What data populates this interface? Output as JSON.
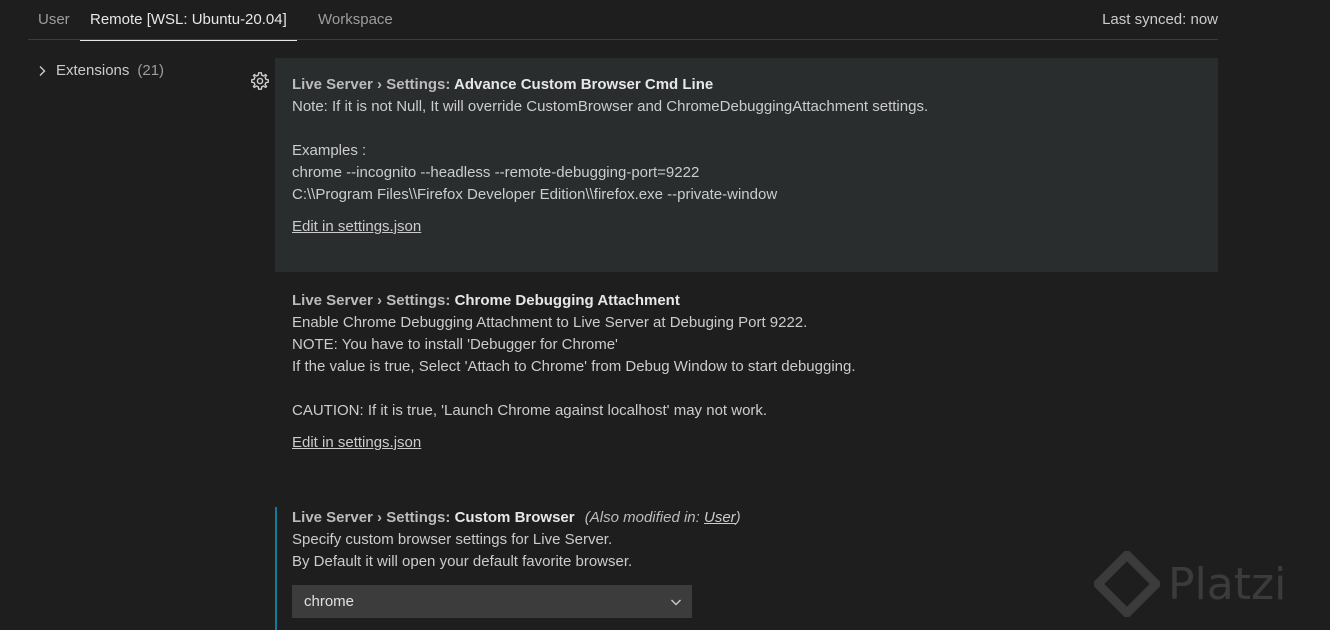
{
  "tabs": [
    {
      "label": "User"
    },
    {
      "label": "Remote [WSL: Ubuntu-20.04]"
    },
    {
      "label": "Workspace"
    }
  ],
  "sync_status": "Last synced: now",
  "toc": {
    "label": "Extensions",
    "count": "(21)"
  },
  "settings": [
    {
      "category": "Live Server › Settings: ",
      "name": "Advance Custom Browser Cmd Line",
      "lines": [
        "Note: If it is not Null, It will override CustomBrowser and ChromeDebuggingAttachment settings.",
        "",
        "Examples :",
        "chrome --incognito --headless --remote-debugging-port=9222",
        "C:\\\\Program Files\\\\Firefox Developer Edition\\\\firefox.exe --private-window"
      ],
      "link": "Edit in settings.json"
    },
    {
      "category": "Live Server › Settings: ",
      "name": "Chrome Debugging Attachment",
      "lines": [
        "Enable Chrome Debugging Attachment to Live Server at Debuging Port 9222.",
        "NOTE: You have to install 'Debugger for Chrome'",
        "If the value is true, Select 'Attach to Chrome' from Debug Window to start debugging.",
        "",
        "CAUTION: If it is true, 'Launch Chrome against localhost' may not work."
      ],
      "link": "Edit in settings.json"
    },
    {
      "category": "Live Server › Settings: ",
      "name": "Custom Browser",
      "also_prefix": "(Also modified in: ",
      "also_link": "User",
      "also_suffix": ")",
      "lines": [
        "Specify custom browser settings for Live Server.",
        "By Default it will open your default favorite browser."
      ],
      "select_value": "chrome"
    }
  ],
  "watermark": "Platzi",
  "icons": {
    "toc_chevron": "chevron-right-icon",
    "gear": "gear-icon",
    "select_arrow": "chevron-down-icon"
  }
}
